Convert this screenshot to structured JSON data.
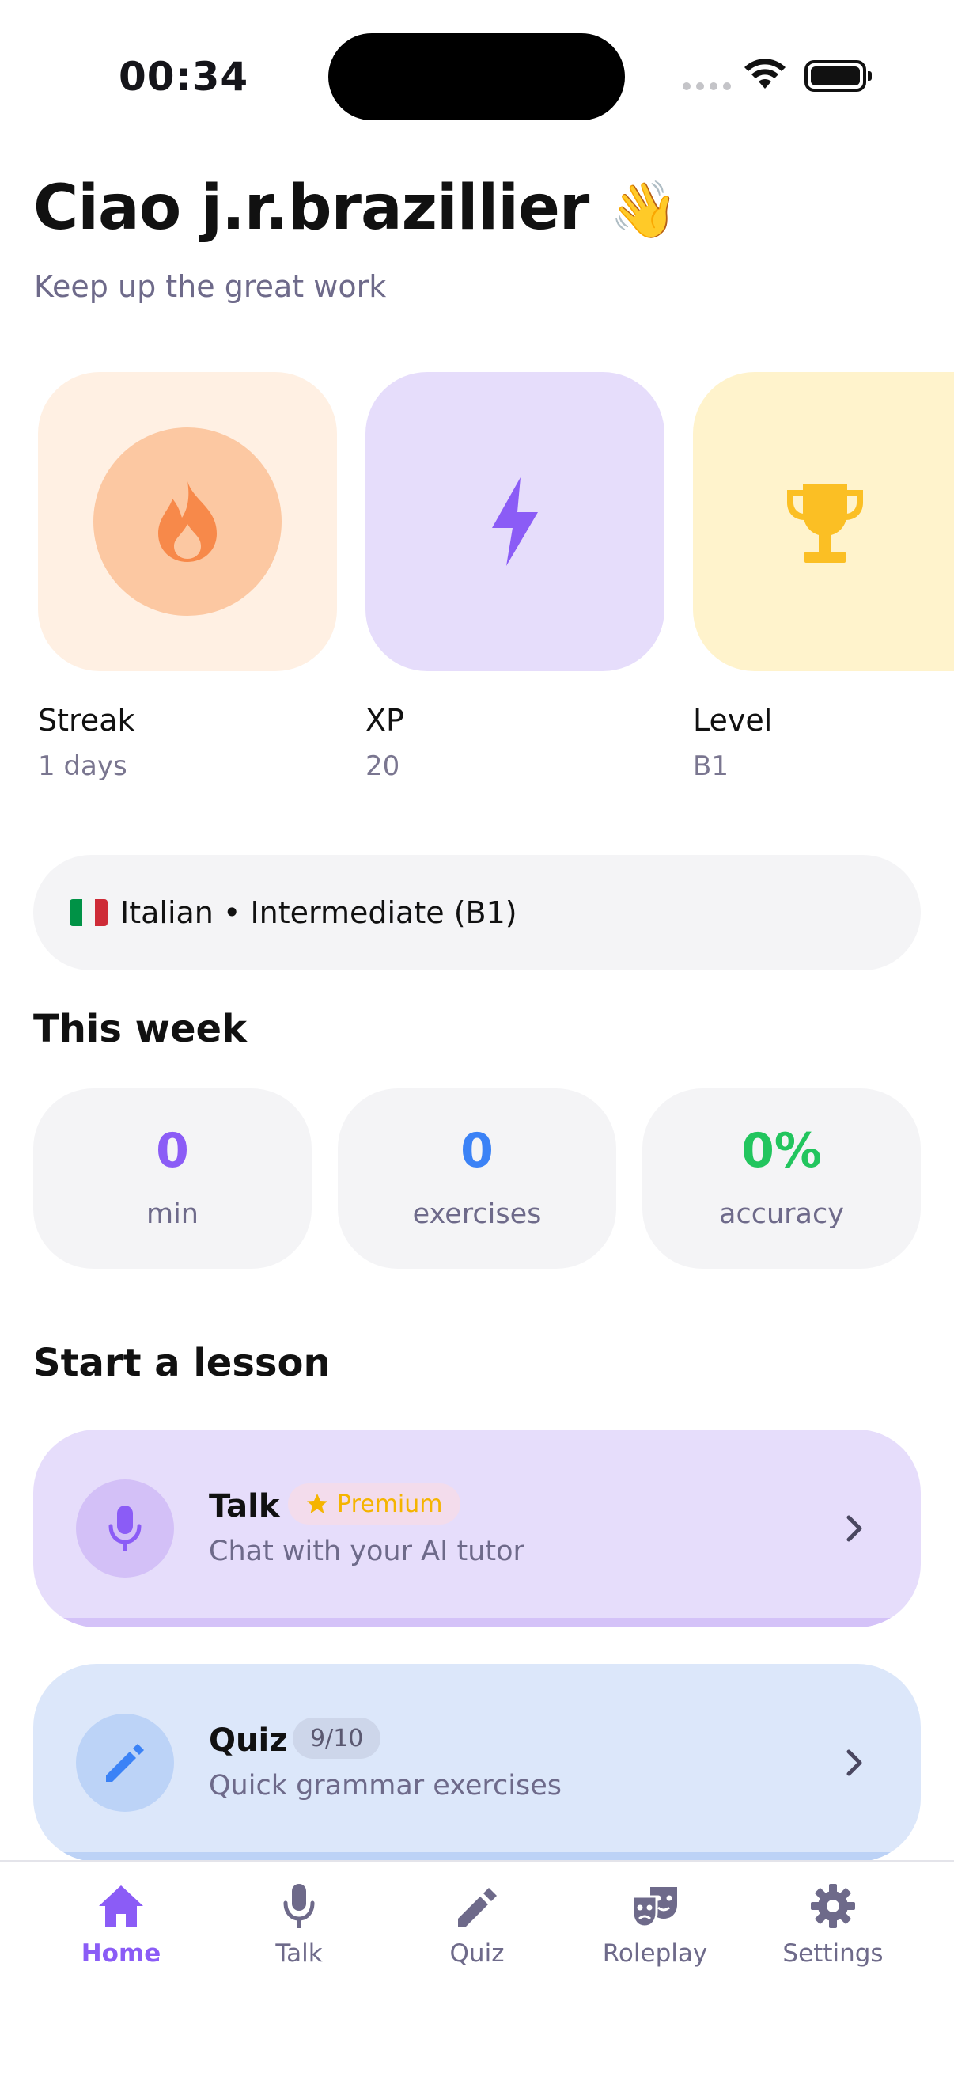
{
  "status_bar": {
    "time": "00:34"
  },
  "greeting": {
    "title": "Ciao j.r.brazillier",
    "emoji": "👋",
    "subtitle": "Keep up the great work"
  },
  "stats": [
    {
      "label": "Streak",
      "value": "1 days",
      "icon": "flame-icon",
      "bg": "#fff0e3",
      "accent": "#f7a86a"
    },
    {
      "label": "XP",
      "value": "20",
      "icon": "lightning-icon",
      "bg": "#e6ddfb",
      "accent": "#8b5cf6"
    },
    {
      "label": "Level",
      "value": "B1",
      "icon": "trophy-icon",
      "bg": "#fff3cc",
      "accent": "#fbbf24"
    }
  ],
  "language": {
    "flag": "italy-flag",
    "text": "Italian • Intermediate (B1)"
  },
  "week": {
    "title": "This week",
    "items": [
      {
        "value": "0",
        "label": "min",
        "color": "#8b5cf6"
      },
      {
        "value": "0",
        "label": "exercises",
        "color": "#3b82f6"
      },
      {
        "value": "0%",
        "label": "accuracy",
        "color": "#22c55e"
      }
    ]
  },
  "lessons": {
    "title": "Start a lesson",
    "items": [
      {
        "title": "Talk",
        "badge": "Premium",
        "subtitle": "Chat with your AI tutor",
        "icon": "microphone-icon",
        "bg": "#e6ddfb",
        "accent": "#8b5cf6"
      },
      {
        "title": "Quiz",
        "badge": "9/10",
        "subtitle": "Quick grammar exercises",
        "icon": "pencil-icon",
        "bg": "#dce7fa",
        "accent": "#3b82f6"
      }
    ]
  },
  "tabs": [
    {
      "label": "Home",
      "icon": "home-icon",
      "active": true
    },
    {
      "label": "Talk",
      "icon": "microphone-icon",
      "active": false
    },
    {
      "label": "Quiz",
      "icon": "pencil-icon",
      "active": false
    },
    {
      "label": "Roleplay",
      "icon": "masks-icon",
      "active": false
    },
    {
      "label": "Settings",
      "icon": "gear-icon",
      "active": false
    }
  ],
  "colors": {
    "accent": "#8b5cf6",
    "muted": "#6e6a8a"
  }
}
